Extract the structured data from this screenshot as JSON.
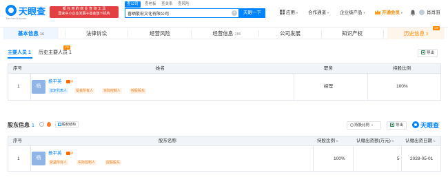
{
  "header": {
    "logo_name": "天眼查",
    "logo_domain": "TianYanCha.com",
    "promo_line1": "都 在 用 的 商 业 查 询 工 具",
    "promo_line2": "国家中小企业发展子基金旗下机构",
    "search_tabs": [
      "查公司",
      "查老板",
      "查关系",
      "查风险"
    ],
    "search_value": "喜晒繁宏文化有限公司",
    "search_button": "天眼一下",
    "nav": {
      "app": "应用",
      "cooperation": "合作通道",
      "enterprise": "企业级产品",
      "vip": "开通会员",
      "user": "肖肖羽"
    }
  },
  "tabs": [
    {
      "label": "基本信息",
      "count": "16"
    },
    {
      "label": "法律诉讼",
      "count": ""
    },
    {
      "label": "经营风险",
      "count": ""
    },
    {
      "label": "经营信息",
      "count": "286"
    },
    {
      "label": "公司发展",
      "count": ""
    },
    {
      "label": "知识产权",
      "count": ""
    },
    {
      "label": "历史信息",
      "count": "3"
    }
  ],
  "vip_tag": "VIP",
  "subtabs": {
    "main": "主要人员",
    "main_count": "1",
    "history": "历史主要人员",
    "history_count": "1",
    "export": "导出"
  },
  "staff_table": {
    "headers": [
      "序号",
      "姓名",
      "职务",
      "持股比例"
    ],
    "rows": [
      {
        "index": "1",
        "avatar": "杨",
        "name": "杨平英",
        "companies": "4",
        "tags": [
          "法定代表人",
          "受益所有人",
          "实际控制人",
          "控股股东"
        ],
        "position": "经理",
        "ratio": "100%"
      }
    ]
  },
  "shareholders": {
    "title": "股东信息",
    "count": "1",
    "equity_button": "股权结构",
    "sort_select": "持股比例",
    "export": "导出",
    "watermark": "天眼查",
    "headers": [
      "序号",
      "股东名称",
      "持股比例",
      "认缴出资额(万元)",
      "认缴出资日期"
    ],
    "rows": [
      {
        "index": "1",
        "avatar": "杨",
        "name": "杨平英",
        "companies": "4",
        "tags": [
          "受益所有人",
          "实际控制人",
          "控股股东"
        ],
        "ratio": "100%",
        "amount": "5",
        "date": "2028-05-01"
      }
    ]
  }
}
